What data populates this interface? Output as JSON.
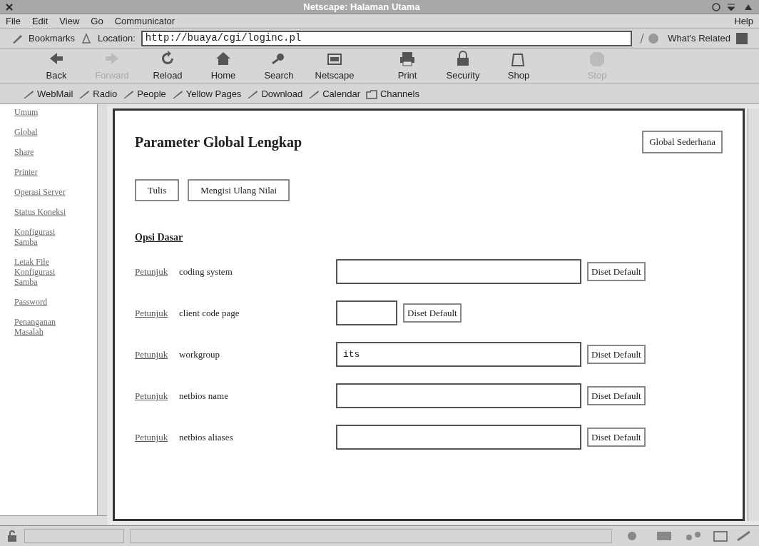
{
  "window": {
    "title": "Netscape: Halaman Utama"
  },
  "menu": {
    "left": [
      "File",
      "Edit",
      "View",
      "Go",
      "Communicator"
    ],
    "right": "Help"
  },
  "location_bar": {
    "bookmarks": "Bookmarks",
    "location_label": "Location:",
    "url": "http://buaya/cgi/loginc.pl",
    "related": "What's Related"
  },
  "toolbar": [
    {
      "label": "Back",
      "disabled": false
    },
    {
      "label": "Forward",
      "disabled": true
    },
    {
      "label": "Reload",
      "disabled": false
    },
    {
      "label": "Home",
      "disabled": false
    },
    {
      "label": "Search",
      "disabled": false
    },
    {
      "label": "Netscape",
      "disabled": false
    },
    {
      "label": "Print",
      "disabled": false
    },
    {
      "label": "Security",
      "disabled": false
    },
    {
      "label": "Shop",
      "disabled": false
    },
    {
      "label": "Stop",
      "disabled": true
    }
  ],
  "personal_bar": [
    {
      "label": "WebMail",
      "kind": "link"
    },
    {
      "label": "Radio",
      "kind": "link"
    },
    {
      "label": "People",
      "kind": "link"
    },
    {
      "label": "Yellow Pages",
      "kind": "link"
    },
    {
      "label": "Download",
      "kind": "link"
    },
    {
      "label": "Calendar",
      "kind": "link"
    },
    {
      "label": "Channels",
      "kind": "folder"
    }
  ],
  "sidebar": {
    "items": [
      "Umum",
      "Global",
      "Share",
      "Printer",
      "Operasi Server",
      "Status Koneksi",
      "Konfigurasi Samba",
      "Letak File Konfigurasi Samba",
      "Password",
      "Penanganan Masalah"
    ]
  },
  "page": {
    "title": "Parameter Global Lengkap",
    "switch_button": "Global Sederhana",
    "buttons": [
      "Tulis",
      "Mengisi Ulang Nilai"
    ],
    "section": "Opsi Dasar",
    "rows": [
      {
        "hint": "Petunjuk",
        "label": "coding system",
        "value": "",
        "wide": true,
        "reset": "Diset Default"
      },
      {
        "hint": "Petunjuk",
        "label": "client code page",
        "value": "",
        "wide": false,
        "reset": "Diset Default"
      },
      {
        "hint": "Petunjuk",
        "label": "workgroup",
        "value": "its",
        "wide": true,
        "reset": "Diset Default"
      },
      {
        "hint": "Petunjuk",
        "label": "netbios name",
        "value": "",
        "wide": true,
        "reset": "Diset Default"
      },
      {
        "hint": "Petunjuk",
        "label": "netbios aliases",
        "value": "",
        "wide": true,
        "reset": "Diset Default"
      }
    ]
  }
}
